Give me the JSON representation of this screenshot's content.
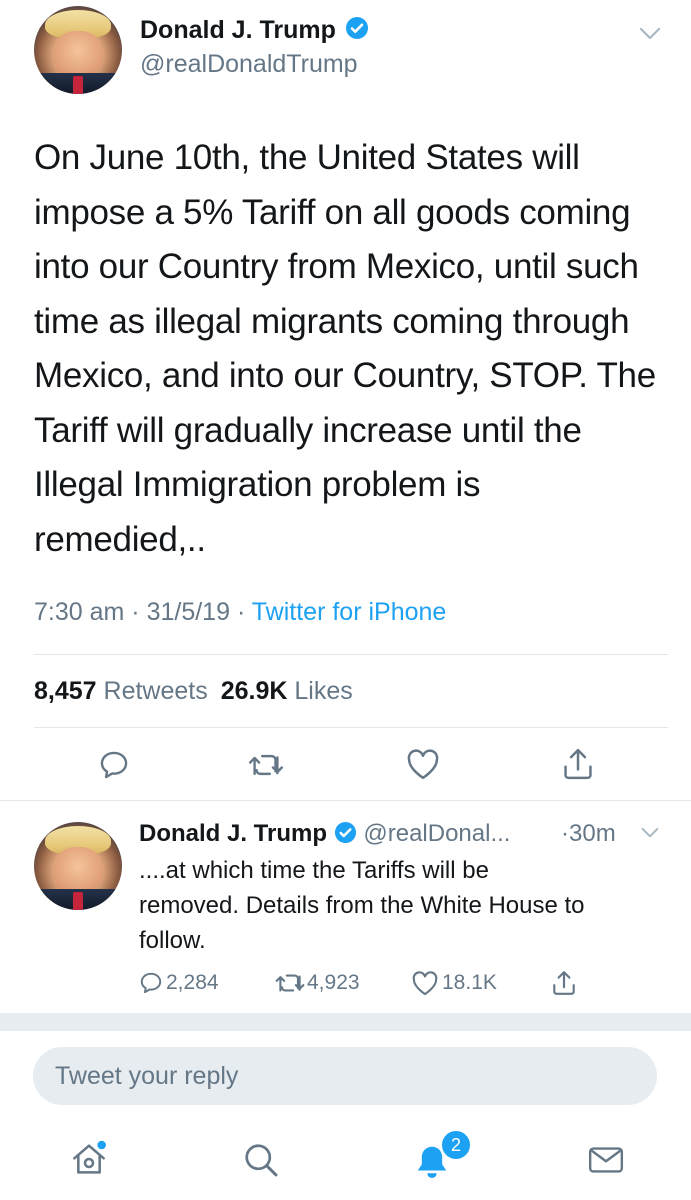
{
  "main_tweet": {
    "display_name": "Donald J. Trump",
    "handle": "@realDonaldTrump",
    "text_lines": [
      "On June 10th, the United States will",
      "impose a 5% Tariff on all goods coming",
      "into our Country from Mexico, until such",
      "time as illegal migrants coming through",
      "Mexico, and into our Country, STOP. The",
      "Tariff will gradually increase until the",
      "Illegal Immigration problem is",
      "remedied,.."
    ],
    "time": "7:30 am",
    "date": "31/5/19",
    "separator": "·",
    "source": "Twitter for iPhone",
    "retweets_count": "8,457",
    "retweets_label": "Retweets",
    "likes_count": "26.9K",
    "likes_label": "Likes"
  },
  "reply_tweet": {
    "display_name": "Donald J. Trump",
    "handle": "@realDonal...",
    "age": "·30m",
    "text_lines": [
      "....at which time the Tariffs will be",
      "removed. Details from the White House to",
      "follow."
    ],
    "replies": "2,284",
    "retweets": "4,923",
    "likes": "18.1K"
  },
  "reply_box": {
    "placeholder": "Tweet your reply"
  },
  "tab_bar": {
    "notifications_badge": "2"
  },
  "colors": {
    "accent": "#1da1f2",
    "secondary_text": "#657786",
    "divider": "#e1e8ed",
    "gap": "#e6ecf0"
  },
  "icons": [
    "verified-badge-icon",
    "chevron-down-icon",
    "reply-icon",
    "retweet-icon",
    "like-icon",
    "share-icon",
    "home-icon",
    "search-icon",
    "notifications-icon",
    "messages-icon"
  ]
}
